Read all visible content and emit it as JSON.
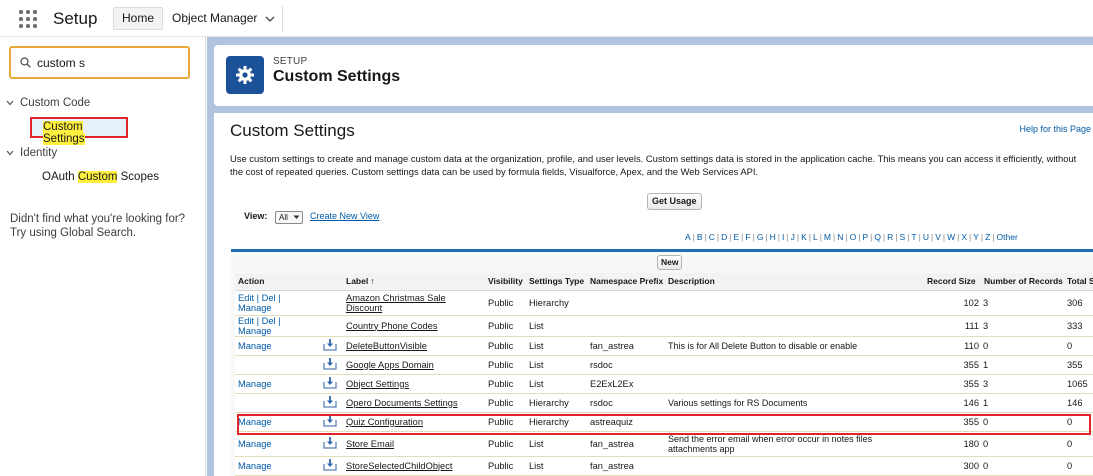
{
  "topbar": {
    "app_title": "Setup",
    "tabs": [
      "Home",
      "Object Manager"
    ]
  },
  "sidebar": {
    "search_value": "custom s",
    "groups": [
      {
        "label": "Custom Code",
        "items": [
          {
            "label": "Custom Settings",
            "active": true
          }
        ]
      },
      {
        "label": "Identity",
        "items": [
          {
            "label": "OAuth Custom Scopes",
            "active": false
          }
        ]
      }
    ],
    "not_found_line1": "Didn't find what you're looking for?",
    "not_found_line2": "Try using Global Search."
  },
  "header": {
    "eyebrow": "SETUP",
    "title": "Custom Settings",
    "icon": "gear-icon",
    "icon_bg": "#1b5297"
  },
  "content": {
    "heading": "Custom Settings",
    "help_link": "Help for this Page",
    "description": "Use custom settings to create and manage custom data at the organization, profile, and user levels. Custom settings data is stored in the application cache. This means you can access it efficiently, without the cost of repeated queries. Custom settings data can be used by formula fields, Visualforce, Apex, and the Web Services API.",
    "get_usage": "Get Usage",
    "view_label": "View:",
    "view_value": "All",
    "create_view": "Create New View",
    "alphabet": [
      "A",
      "B",
      "C",
      "D",
      "E",
      "F",
      "G",
      "H",
      "I",
      "J",
      "K",
      "L",
      "M",
      "N",
      "O",
      "P",
      "Q",
      "R",
      "S",
      "T",
      "U",
      "V",
      "W",
      "X",
      "Y",
      "Z",
      "Other"
    ],
    "new_button": "New"
  },
  "table": {
    "columns": [
      "Action",
      "Label ↑",
      "Visibility",
      "Settings Type",
      "Namespace Prefix",
      "Description",
      "Record Size",
      "Number of Records",
      "Total S"
    ],
    "rows": [
      {
        "action": "Edit | Del | Manage",
        "icon": false,
        "label": "Amazon Christmas Sale Discount",
        "visibility": "Public",
        "type": "Hierarchy",
        "ns": "",
        "desc": "",
        "size": "102",
        "records": "3",
        "total": "306"
      },
      {
        "action": "Edit | Del | Manage",
        "icon": false,
        "label": "Country Phone Codes",
        "visibility": "Public",
        "type": "List",
        "ns": "",
        "desc": "",
        "size": "111",
        "records": "3",
        "total": "333"
      },
      {
        "action": "Manage",
        "icon": true,
        "label": "DeleteButtonVisible",
        "visibility": "Public",
        "type": "List",
        "ns": "fan_astrea",
        "desc": "This is for All Delete Button to disable or enable",
        "size": "110",
        "records": "0",
        "total": "0"
      },
      {
        "action": "",
        "icon": true,
        "label": "Google Apps Domain",
        "visibility": "Public",
        "type": "List",
        "ns": "rsdoc",
        "desc": "",
        "size": "355",
        "records": "1",
        "total": "355"
      },
      {
        "action": "Manage",
        "icon": true,
        "label": "Object Settings",
        "visibility": "Public",
        "type": "List",
        "ns": "E2ExL2Ex",
        "desc": "",
        "size": "355",
        "records": "3",
        "total": "1065"
      },
      {
        "action": "",
        "icon": true,
        "label": "Opero Documents Settings",
        "visibility": "Public",
        "type": "Hierarchy",
        "ns": "rsdoc",
        "desc": "Various settings for RS Documents",
        "size": "146",
        "records": "1",
        "total": "146"
      },
      {
        "action": "Manage",
        "icon": true,
        "label": "Quiz Configuration",
        "visibility": "Public",
        "type": "Hierarchy",
        "ns": "astreaquiz",
        "desc": "",
        "size": "355",
        "records": "0",
        "total": "0"
      },
      {
        "action": "Manage",
        "icon": true,
        "label": "Store Email",
        "visibility": "Public",
        "type": "List",
        "ns": "fan_astrea",
        "desc": "Send the error email when error occur in notes files attachments app",
        "size": "180",
        "records": "0",
        "total": "0"
      },
      {
        "action": "Manage",
        "icon": true,
        "label": "StoreSelectedChildObject",
        "visibility": "Public",
        "type": "List",
        "ns": "fan_astrea",
        "desc": "",
        "size": "300",
        "records": "0",
        "total": "0"
      }
    ]
  },
  "colors": {
    "link": "#015ba7",
    "highlight": "#fff03f",
    "callout": "#e0242b",
    "header_band": "#b0c4df"
  }
}
